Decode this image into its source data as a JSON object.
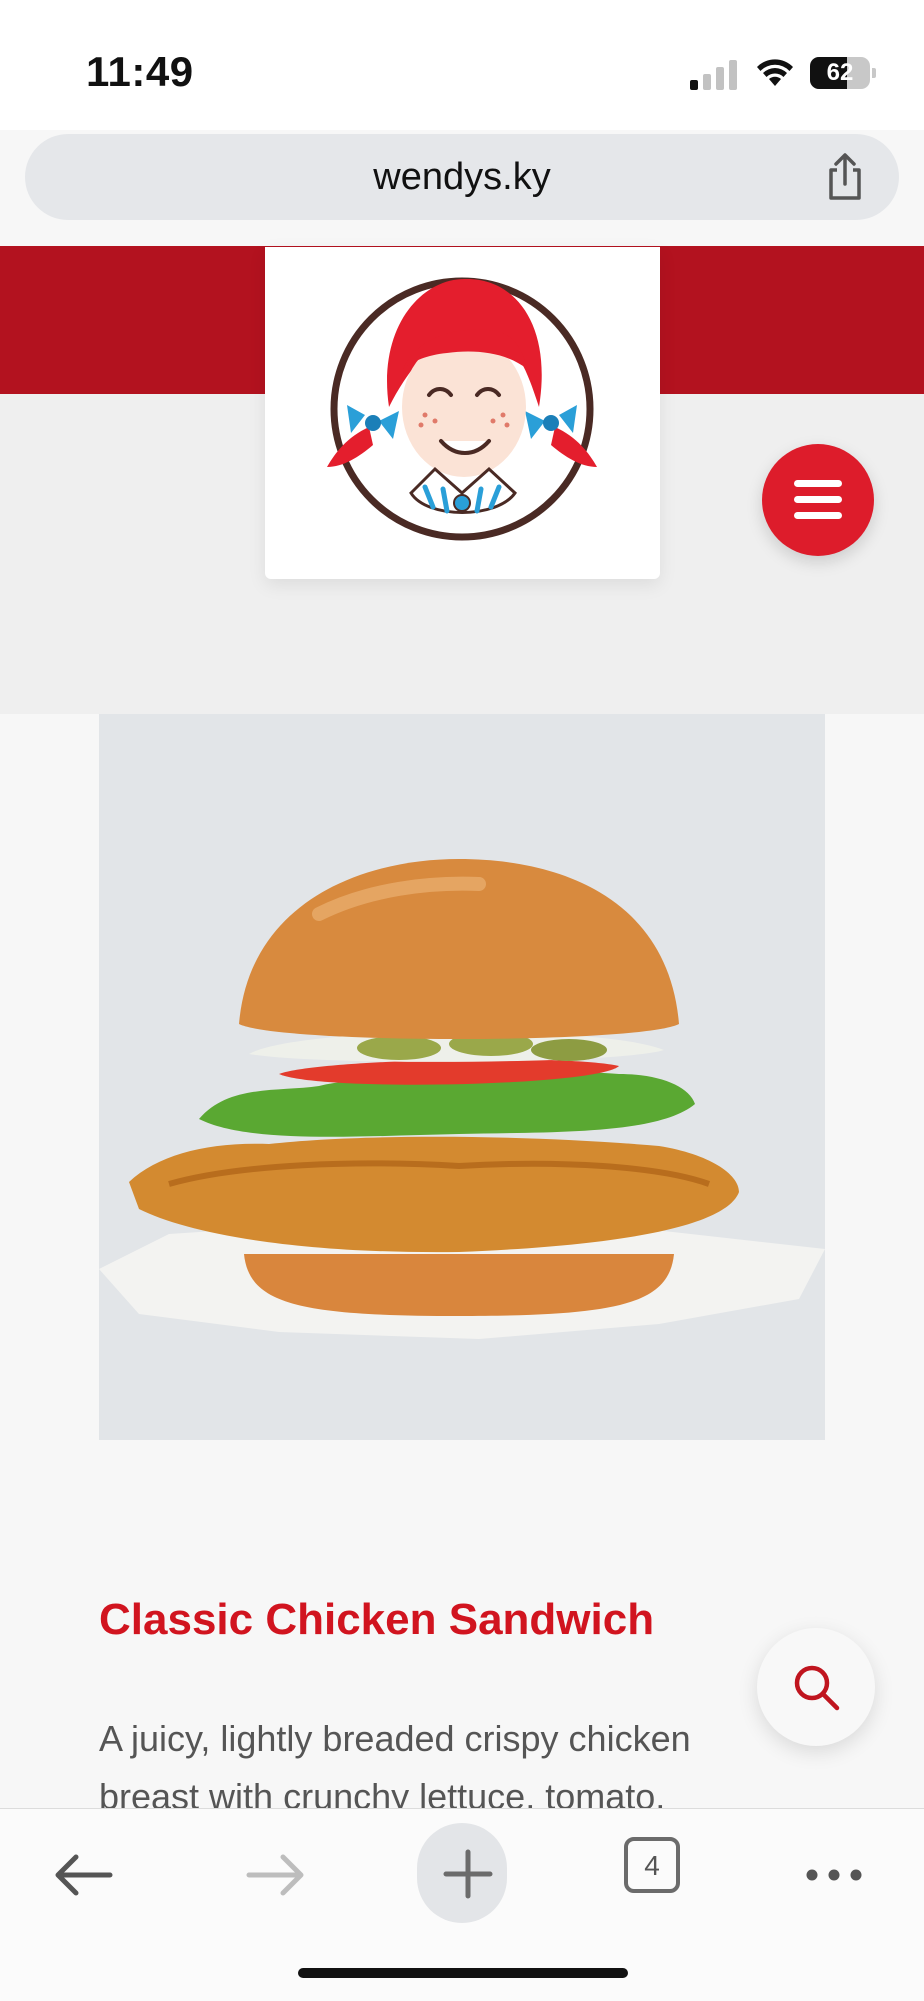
{
  "status_bar": {
    "time": "11:49",
    "battery_level": "62",
    "battery_fraction": 0.62,
    "signal_bars_active": 1,
    "icons": [
      "signal-icon",
      "wifi-icon",
      "battery-icon"
    ]
  },
  "browser": {
    "url": "wendys.ky",
    "share_icon": "share-icon",
    "tab_count": "4",
    "toolbar_icons": [
      "back-arrow-icon",
      "forward-arrow-icon",
      "plus-icon",
      "tabs-icon",
      "more-dots-icon"
    ]
  },
  "header": {
    "logo_icon": "wendys-logo",
    "menu_icon": "hamburger-icon"
  },
  "product": {
    "title": "Classic Chicken Sandwich",
    "description_lines": [
      "A juicy, lightly breaded crispy chicken",
      "breast with crunchy lettuce, tomato,"
    ]
  },
  "colors": {
    "brand_red": "#dd1c2b",
    "header_red": "#b3121f",
    "title_red": "#d1141f",
    "image_bg": "#e2e5e8"
  }
}
